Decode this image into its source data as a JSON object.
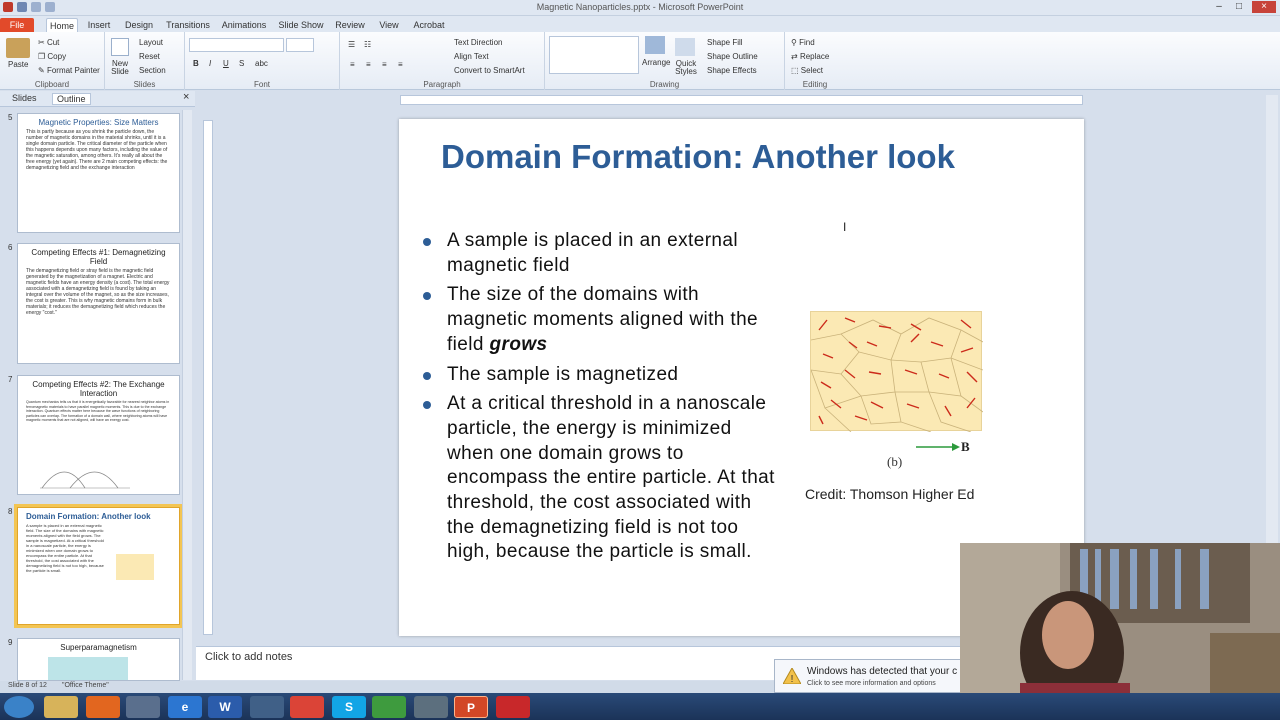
{
  "window": {
    "title": "Magnetic Nanoparticles.pptx - Microsoft PowerPoint"
  },
  "tabs": [
    "File",
    "Home",
    "Insert",
    "Design",
    "Transitions",
    "Animations",
    "Slide Show",
    "Review",
    "View",
    "Acrobat"
  ],
  "ribbon": {
    "clipboard": {
      "paste": "Paste",
      "cut": "Cut",
      "copy": "Copy",
      "format_painter": "Format Painter",
      "name": "Clipboard"
    },
    "slides": {
      "new_slide": "New Slide",
      "layout": "Layout",
      "reset": "Reset",
      "section": "Section",
      "name": "Slides"
    },
    "font": {
      "name": "Font"
    },
    "paragraph": {
      "text_direction": "Text Direction",
      "align_text": "Align Text",
      "convert": "Convert to SmartArt",
      "name": "Paragraph"
    },
    "drawing": {
      "arrange": "Arrange",
      "quick_styles": "Quick Styles",
      "shape_fill": "Shape Fill",
      "shape_outline": "Shape Outline",
      "shape_effects": "Shape Effects",
      "name": "Drawing"
    },
    "editing": {
      "find": "Find",
      "replace": "Replace",
      "select": "Select",
      "name": "Editing"
    }
  },
  "panel": {
    "tabs": [
      "Slides",
      "Outline"
    ],
    "thumbs": [
      {
        "num": "5",
        "title": "Magnetic Properties: Size Matters",
        "body": "This is partly because as you shrink the particle down, the number of magnetic domains in the material shrinks, until it is a single domain particle. The critical diameter of the particle when this happens depends upon many factors, including the value of the magnetic saturation, among others. It's really all about the free energy (yet again). There are 2 main competing effects: the demagnetizing field and the exchange interaction"
      },
      {
        "num": "6",
        "title": "Competing Effects #1: Demagnetizing Field",
        "body": "The demagnetizing field or stray field is the magnetic field generated by the magnetization of a magnet. Electric and magnetic fields have an energy density (a cost). The total energy associated with a demagnetizing field is found by taking an integral over the volume of the magnet, so as the size increases, the cost is greater. This is why magnetic domains form in bulk materials; it reduces the demagnetizing field which reduces the energy \"cost.\""
      },
      {
        "num": "7",
        "title": "Competing Effects #2: The Exchange Interaction",
        "body": "Quantum mechanics tells us that it is energetically favorable for nearest neighbor atoms in ferromagnetic materials to have parallel magnetic moments. This is due to the exchange interaction. Quantum effects matter here because the wave functions of neighboring particles can overlap. The formation of a domain wall, where neighboring atoms will have magnetic moments that are not aligned, will have an energy cost."
      },
      {
        "num": "8",
        "title": "Domain Formation: Another look",
        "body": "A sample is placed in an external magnetic field. The size of the domains with magnetic moments aligned with the field grows. The sample is magnetized. At a critical threshold in a nanoscale particle, the energy is minimized when one domain grows to encompass the entire particle. At that threshold, the cost associated with the demagnetizing field is not too high, because the particle is small."
      },
      {
        "num": "9",
        "title": "Superparamagnetism",
        "body": ""
      }
    ]
  },
  "slide": {
    "title": "Domain Formation: Another look",
    "bullets": [
      {
        "text": "A sample is placed in an external magnetic field"
      },
      {
        "pre": "The size of the domains with magnetic moments aligned with the field ",
        "em": "grows"
      },
      {
        "text": "The sample is magnetized"
      },
      {
        "text": "At a critical threshold in a nanoscale particle, the energy is minimized when one domain grows to encompass the entire particle. At that threshold, the cost associated with the demagnetizing field is not too high, because the particle is small."
      }
    ],
    "figure_label": "(b)",
    "vector_label": "B",
    "credit": "Credit: Thomson Higher Ed"
  },
  "notes": {
    "placeholder": "Click to add notes"
  },
  "status": {
    "slide": "Slide 8 of 12",
    "theme": "\"Office Theme\""
  },
  "notification": {
    "title": "Windows has detected that your c",
    "sub": "Click to see more information and options"
  },
  "colors": {
    "title": "#2d5d96",
    "file_tab": "#e24a2a",
    "selected_thumb": "#f3c553",
    "domain_bg": "#fbe9b4",
    "arrow": "#cc2a1a"
  }
}
